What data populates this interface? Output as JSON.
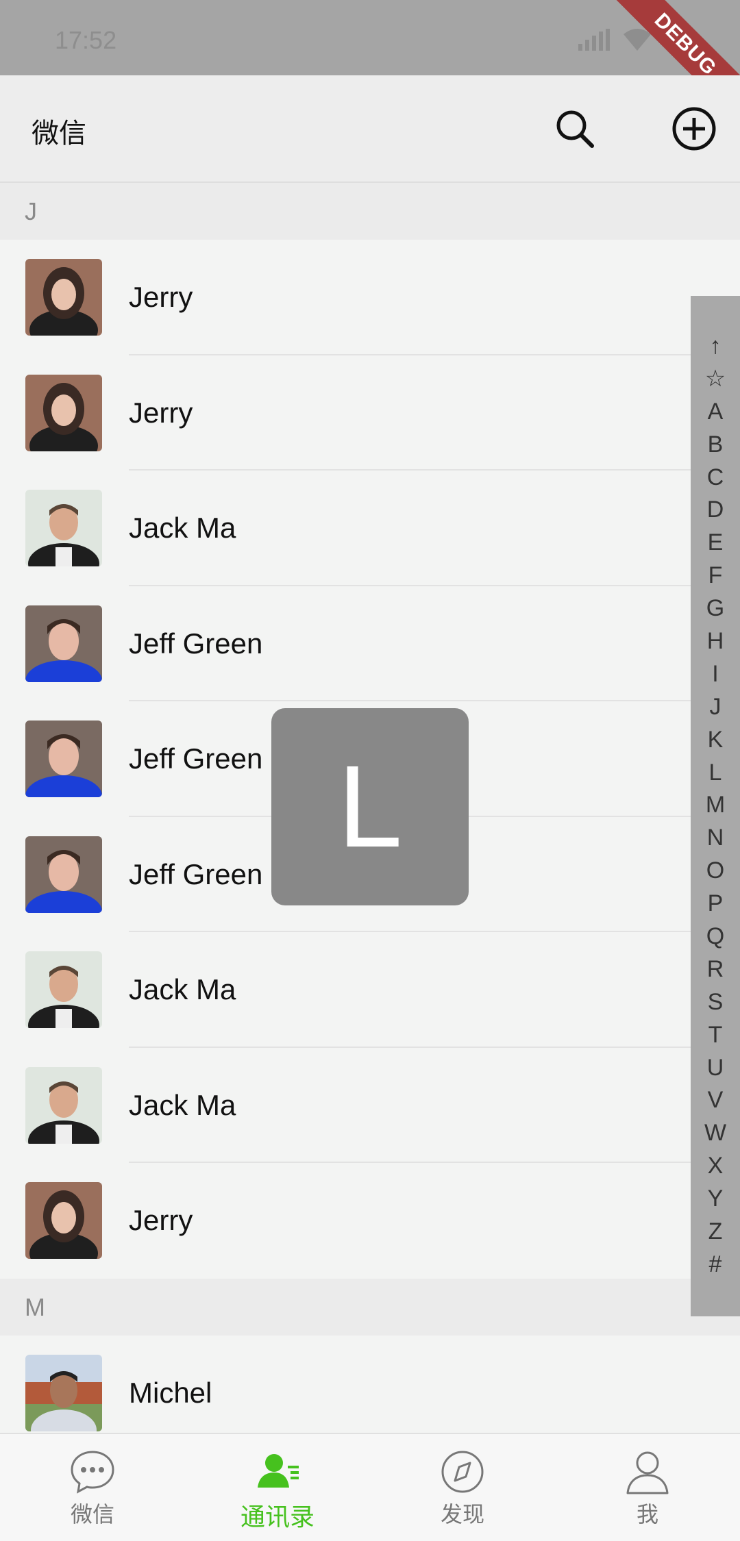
{
  "status_bar": {
    "time": "17:52"
  },
  "debug_label": "DEBUG",
  "app_bar": {
    "title": "微信",
    "search_icon": "search-icon",
    "add_icon": "plus-circle-icon"
  },
  "sections": [
    {
      "letter": "J",
      "contacts": [
        {
          "name": "Jerry",
          "avatar": "woman-portrait"
        },
        {
          "name": "Jerry",
          "avatar": "woman-portrait"
        },
        {
          "name": "Jack Ma",
          "avatar": "man-smiling-portrait"
        },
        {
          "name": "Jeff Green",
          "avatar": "young-man-portrait"
        },
        {
          "name": "Jeff Green",
          "avatar": "young-man-portrait"
        },
        {
          "name": "Jeff Green",
          "avatar": "young-man-portrait"
        },
        {
          "name": "Jack Ma",
          "avatar": "man-smiling-portrait"
        },
        {
          "name": "Jack Ma",
          "avatar": "man-smiling-portrait"
        },
        {
          "name": "Jerry",
          "avatar": "woman-portrait"
        }
      ]
    },
    {
      "letter": "M",
      "contacts": [
        {
          "name": "Michel",
          "avatar": "bearded-man-portrait"
        }
      ]
    }
  ],
  "index_letters": [
    "↑",
    "☆",
    "A",
    "B",
    "C",
    "D",
    "E",
    "F",
    "G",
    "H",
    "I",
    "J",
    "K",
    "L",
    "M",
    "N",
    "O",
    "P",
    "Q",
    "R",
    "S",
    "T",
    "U",
    "V",
    "W",
    "X",
    "Y",
    "Z",
    "#"
  ],
  "overlay_letter": "L",
  "bottom_nav": [
    {
      "label": "微信",
      "icon": "chat-bubble-icon",
      "active": false
    },
    {
      "label": "通讯录",
      "icon": "contacts-icon",
      "active": true
    },
    {
      "label": "发现",
      "icon": "compass-icon",
      "active": false
    },
    {
      "label": "我",
      "icon": "person-icon",
      "active": false
    }
  ],
  "colors": {
    "accent": "#46c11e",
    "debug": "#a63b3b"
  }
}
